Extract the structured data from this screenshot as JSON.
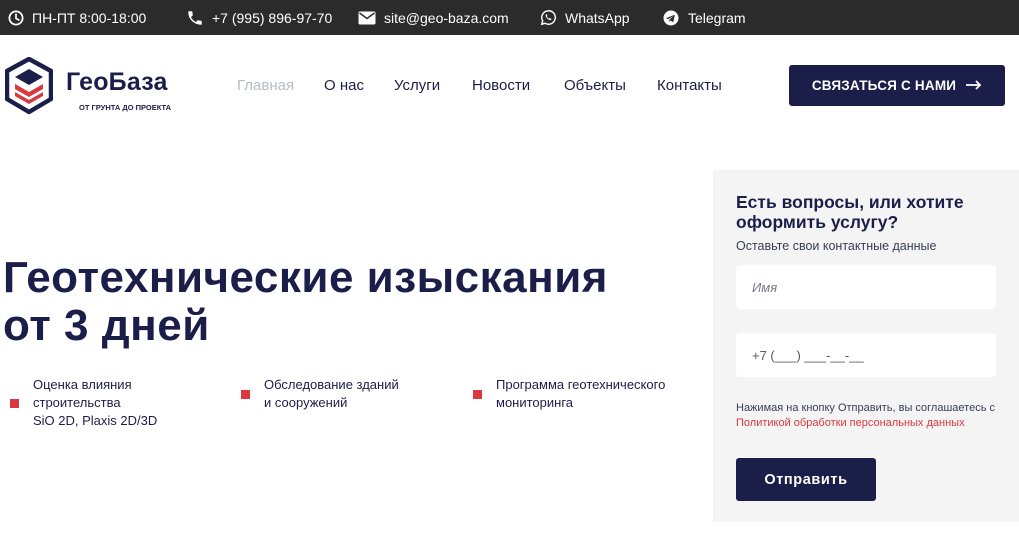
{
  "topbar": {
    "hours": "ПН-ПТ 8:00-18:00",
    "phone": "+7 (995) 896-97-70",
    "email": "site@geo-baza.com",
    "whatsapp": "WhatsApp",
    "telegram": "Telegram",
    "icons": [
      "clock-icon",
      "phone-icon",
      "mail-icon",
      "whatsapp-icon",
      "telegram-icon"
    ]
  },
  "brand": {
    "name": "ГеоБаза",
    "tagline": "ОТ ГРУНТА ДО ПРОЕКТА"
  },
  "nav": {
    "items": [
      {
        "label": "Главная",
        "active": true
      },
      {
        "label": "О нас"
      },
      {
        "label": "Услуги"
      },
      {
        "label": "Новости"
      },
      {
        "label": "Объекты"
      },
      {
        "label": "Контакты"
      }
    ]
  },
  "cta": {
    "label": "СВЯЗАТЬСЯ С НАМИ"
  },
  "hero": {
    "title_line1": "Геотехнические изыскания",
    "title_line2": "от 3 дней",
    "features": [
      {
        "lines": [
          "Оценка влияния",
          "строительства",
          "SiO 2D, Plaxis 2D/3D"
        ]
      },
      {
        "lines": [
          "Обследование зданий",
          "и сооружений"
        ]
      },
      {
        "lines": [
          "Программа геотехнического",
          "мониторинга"
        ]
      }
    ]
  },
  "form": {
    "title_line1": "Есть вопросы, или хотите",
    "title_line2": "оформить услугу?",
    "subtitle": "Оставьте свои контактные данные",
    "name_placeholder": "Имя",
    "phone_placeholder": "+7 (___) ___-__-__",
    "consent_text": "Нажимая на кнопку Отправить, вы соглашаетесь с ",
    "consent_link": "Политикой обработки персональных данных",
    "submit_label": "Отправить"
  },
  "colors": {
    "navy": "#1c1e4a",
    "accent_red": "#d9383f",
    "topbar_bg": "#2b2b2b",
    "panel_bg": "#f4f4f4",
    "nav_active": "#b9bcc7"
  }
}
